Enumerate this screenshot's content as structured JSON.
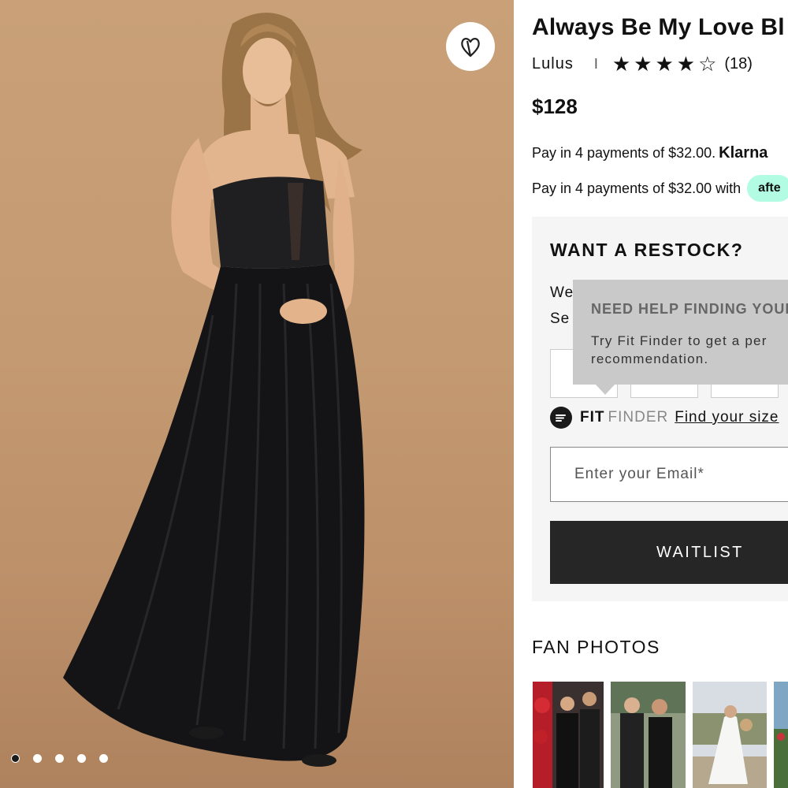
{
  "product": {
    "title": "Always Be My Love Bl",
    "brand": "Lulus",
    "separator": "I",
    "rating": {
      "value": 4,
      "max": 5,
      "count_label": "(18)"
    },
    "price": "$128"
  },
  "payments": {
    "klarna_text": "Pay in 4 payments of $32.00.",
    "klarna_brand": "Klarna",
    "afterpay_text": "Pay in 4 payments of $32.00 with",
    "afterpay_badge": "afte"
  },
  "restock": {
    "title": "WANT A RESTOCK?",
    "text_line1": "We",
    "text_line2": "Se",
    "fit_finder": {
      "fit": "FIT",
      "finder": "FINDER",
      "link": "Find your size"
    },
    "email_placeholder": "Enter your Email*",
    "waitlist_label": "WAITLIST"
  },
  "tooltip": {
    "title": "NEED HELP FINDING YOUR",
    "line1": "Try Fit Finder to get a per",
    "line2": "recommendation."
  },
  "fan_photos": {
    "title": "FAN PHOTOS"
  },
  "gallery": {
    "dots": 5,
    "active_dot": 0
  },
  "colors": {
    "afterpay_mint": "#b2fce4",
    "dark_button": "#262626",
    "panel_bg": "#f5f5f5"
  }
}
